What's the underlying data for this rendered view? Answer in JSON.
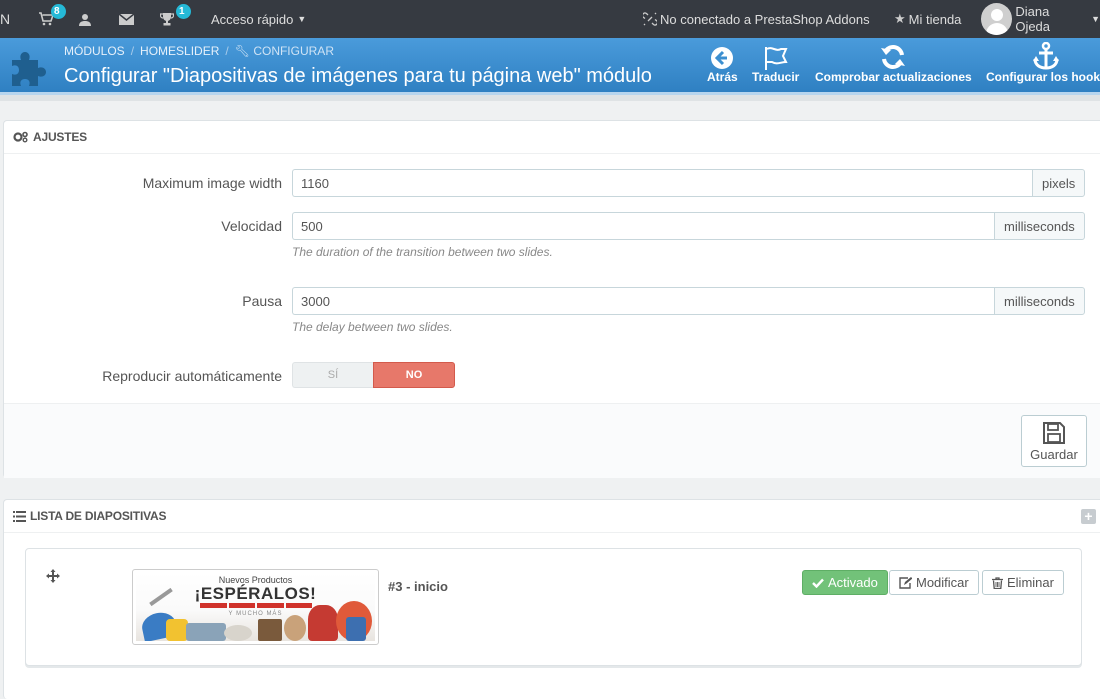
{
  "topbar": {
    "cut_label": "N",
    "cart_badge": "8",
    "trophy_badge": "1",
    "quick_access": "Acceso rápido",
    "addons_status": "No conectado a PrestaShop Addons",
    "my_store": "Mi tienda",
    "user_name": "Diana Ojeda"
  },
  "header": {
    "breadcrumb": [
      "MÓDULOS",
      "HOMESLIDER",
      "CONFIGURAR"
    ],
    "title": "Configurar \"Diapositivas de imágenes para tu página web\" módulo",
    "buttons": {
      "back": "Atrás",
      "translate": "Traducir",
      "check_updates": "Comprobar actualizaciones",
      "hooks": "Configurar los hooks"
    }
  },
  "settings": {
    "title": "AJUSTES",
    "max_width": {
      "label": "Maximum image width",
      "value": "1160",
      "unit": "pixels"
    },
    "speed": {
      "label": "Velocidad",
      "value": "500",
      "unit": "milliseconds",
      "help": "The duration of the transition between two slides."
    },
    "pause": {
      "label": "Pausa",
      "value": "3000",
      "unit": "milliseconds",
      "help": "The delay between two slides."
    },
    "autoplay": {
      "label": "Reproducir automáticamente",
      "yes": "SÍ",
      "no": "NO",
      "selected": "NO"
    },
    "save": "Guardar"
  },
  "slides": {
    "title": "LISTA DE DIAPOSITIVAS",
    "items": [
      {
        "title": "#3 - inicio",
        "banner_line1": "Nuevos Productos",
        "banner_line2": "¡ESPÉRALOS!",
        "banner_line3": "Y MUCHO MÁS",
        "status": "Activado",
        "edit": "Modificar",
        "delete": "Eliminar"
      }
    ]
  },
  "colors": {
    "topbar": "#363a41",
    "header": "#3c8fd0",
    "switch_no": "#e7786a",
    "active": "#72c279",
    "badge": "#25b9d7"
  }
}
